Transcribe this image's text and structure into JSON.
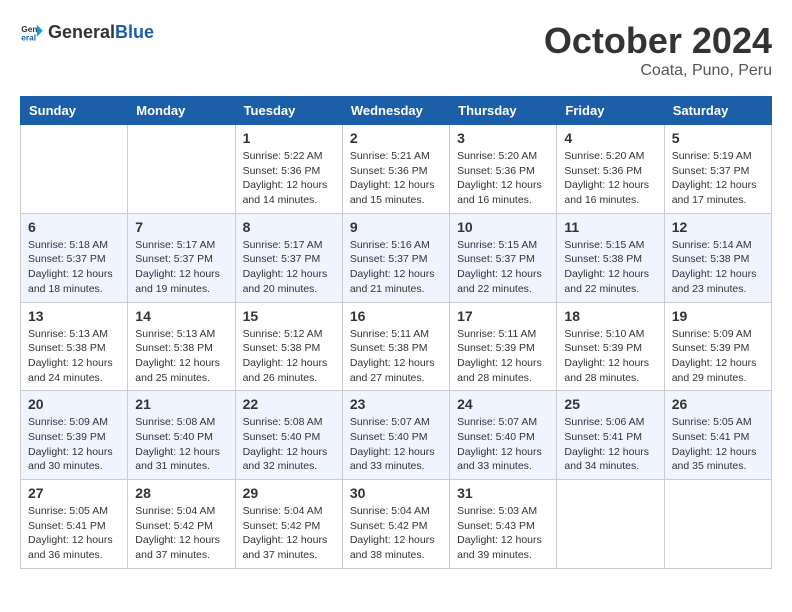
{
  "header": {
    "logo_general": "General",
    "logo_blue": "Blue",
    "month_year": "October 2024",
    "location": "Coata, Puno, Peru"
  },
  "days_of_week": [
    "Sunday",
    "Monday",
    "Tuesday",
    "Wednesday",
    "Thursday",
    "Friday",
    "Saturday"
  ],
  "weeks": [
    [
      {
        "day": "",
        "sunrise": "",
        "sunset": "",
        "daylight": ""
      },
      {
        "day": "",
        "sunrise": "",
        "sunset": "",
        "daylight": ""
      },
      {
        "day": "1",
        "sunrise": "Sunrise: 5:22 AM",
        "sunset": "Sunset: 5:36 PM",
        "daylight": "Daylight: 12 hours and 14 minutes."
      },
      {
        "day": "2",
        "sunrise": "Sunrise: 5:21 AM",
        "sunset": "Sunset: 5:36 PM",
        "daylight": "Daylight: 12 hours and 15 minutes."
      },
      {
        "day": "3",
        "sunrise": "Sunrise: 5:20 AM",
        "sunset": "Sunset: 5:36 PM",
        "daylight": "Daylight: 12 hours and 16 minutes."
      },
      {
        "day": "4",
        "sunrise": "Sunrise: 5:20 AM",
        "sunset": "Sunset: 5:36 PM",
        "daylight": "Daylight: 12 hours and 16 minutes."
      },
      {
        "day": "5",
        "sunrise": "Sunrise: 5:19 AM",
        "sunset": "Sunset: 5:37 PM",
        "daylight": "Daylight: 12 hours and 17 minutes."
      }
    ],
    [
      {
        "day": "6",
        "sunrise": "Sunrise: 5:18 AM",
        "sunset": "Sunset: 5:37 PM",
        "daylight": "Daylight: 12 hours and 18 minutes."
      },
      {
        "day": "7",
        "sunrise": "Sunrise: 5:17 AM",
        "sunset": "Sunset: 5:37 PM",
        "daylight": "Daylight: 12 hours and 19 minutes."
      },
      {
        "day": "8",
        "sunrise": "Sunrise: 5:17 AM",
        "sunset": "Sunset: 5:37 PM",
        "daylight": "Daylight: 12 hours and 20 minutes."
      },
      {
        "day": "9",
        "sunrise": "Sunrise: 5:16 AM",
        "sunset": "Sunset: 5:37 PM",
        "daylight": "Daylight: 12 hours and 21 minutes."
      },
      {
        "day": "10",
        "sunrise": "Sunrise: 5:15 AM",
        "sunset": "Sunset: 5:37 PM",
        "daylight": "Daylight: 12 hours and 22 minutes."
      },
      {
        "day": "11",
        "sunrise": "Sunrise: 5:15 AM",
        "sunset": "Sunset: 5:38 PM",
        "daylight": "Daylight: 12 hours and 22 minutes."
      },
      {
        "day": "12",
        "sunrise": "Sunrise: 5:14 AM",
        "sunset": "Sunset: 5:38 PM",
        "daylight": "Daylight: 12 hours and 23 minutes."
      }
    ],
    [
      {
        "day": "13",
        "sunrise": "Sunrise: 5:13 AM",
        "sunset": "Sunset: 5:38 PM",
        "daylight": "Daylight: 12 hours and 24 minutes."
      },
      {
        "day": "14",
        "sunrise": "Sunrise: 5:13 AM",
        "sunset": "Sunset: 5:38 PM",
        "daylight": "Daylight: 12 hours and 25 minutes."
      },
      {
        "day": "15",
        "sunrise": "Sunrise: 5:12 AM",
        "sunset": "Sunset: 5:38 PM",
        "daylight": "Daylight: 12 hours and 26 minutes."
      },
      {
        "day": "16",
        "sunrise": "Sunrise: 5:11 AM",
        "sunset": "Sunset: 5:38 PM",
        "daylight": "Daylight: 12 hours and 27 minutes."
      },
      {
        "day": "17",
        "sunrise": "Sunrise: 5:11 AM",
        "sunset": "Sunset: 5:39 PM",
        "daylight": "Daylight: 12 hours and 28 minutes."
      },
      {
        "day": "18",
        "sunrise": "Sunrise: 5:10 AM",
        "sunset": "Sunset: 5:39 PM",
        "daylight": "Daylight: 12 hours and 28 minutes."
      },
      {
        "day": "19",
        "sunrise": "Sunrise: 5:09 AM",
        "sunset": "Sunset: 5:39 PM",
        "daylight": "Daylight: 12 hours and 29 minutes."
      }
    ],
    [
      {
        "day": "20",
        "sunrise": "Sunrise: 5:09 AM",
        "sunset": "Sunset: 5:39 PM",
        "daylight": "Daylight: 12 hours and 30 minutes."
      },
      {
        "day": "21",
        "sunrise": "Sunrise: 5:08 AM",
        "sunset": "Sunset: 5:40 PM",
        "daylight": "Daylight: 12 hours and 31 minutes."
      },
      {
        "day": "22",
        "sunrise": "Sunrise: 5:08 AM",
        "sunset": "Sunset: 5:40 PM",
        "daylight": "Daylight: 12 hours and 32 minutes."
      },
      {
        "day": "23",
        "sunrise": "Sunrise: 5:07 AM",
        "sunset": "Sunset: 5:40 PM",
        "daylight": "Daylight: 12 hours and 33 minutes."
      },
      {
        "day": "24",
        "sunrise": "Sunrise: 5:07 AM",
        "sunset": "Sunset: 5:40 PM",
        "daylight": "Daylight: 12 hours and 33 minutes."
      },
      {
        "day": "25",
        "sunrise": "Sunrise: 5:06 AM",
        "sunset": "Sunset: 5:41 PM",
        "daylight": "Daylight: 12 hours and 34 minutes."
      },
      {
        "day": "26",
        "sunrise": "Sunrise: 5:05 AM",
        "sunset": "Sunset: 5:41 PM",
        "daylight": "Daylight: 12 hours and 35 minutes."
      }
    ],
    [
      {
        "day": "27",
        "sunrise": "Sunrise: 5:05 AM",
        "sunset": "Sunset: 5:41 PM",
        "daylight": "Daylight: 12 hours and 36 minutes."
      },
      {
        "day": "28",
        "sunrise": "Sunrise: 5:04 AM",
        "sunset": "Sunset: 5:42 PM",
        "daylight": "Daylight: 12 hours and 37 minutes."
      },
      {
        "day": "29",
        "sunrise": "Sunrise: 5:04 AM",
        "sunset": "Sunset: 5:42 PM",
        "daylight": "Daylight: 12 hours and 37 minutes."
      },
      {
        "day": "30",
        "sunrise": "Sunrise: 5:04 AM",
        "sunset": "Sunset: 5:42 PM",
        "daylight": "Daylight: 12 hours and 38 minutes."
      },
      {
        "day": "31",
        "sunrise": "Sunrise: 5:03 AM",
        "sunset": "Sunset: 5:43 PM",
        "daylight": "Daylight: 12 hours and 39 minutes."
      },
      {
        "day": "",
        "sunrise": "",
        "sunset": "",
        "daylight": ""
      },
      {
        "day": "",
        "sunrise": "",
        "sunset": "",
        "daylight": ""
      }
    ]
  ]
}
